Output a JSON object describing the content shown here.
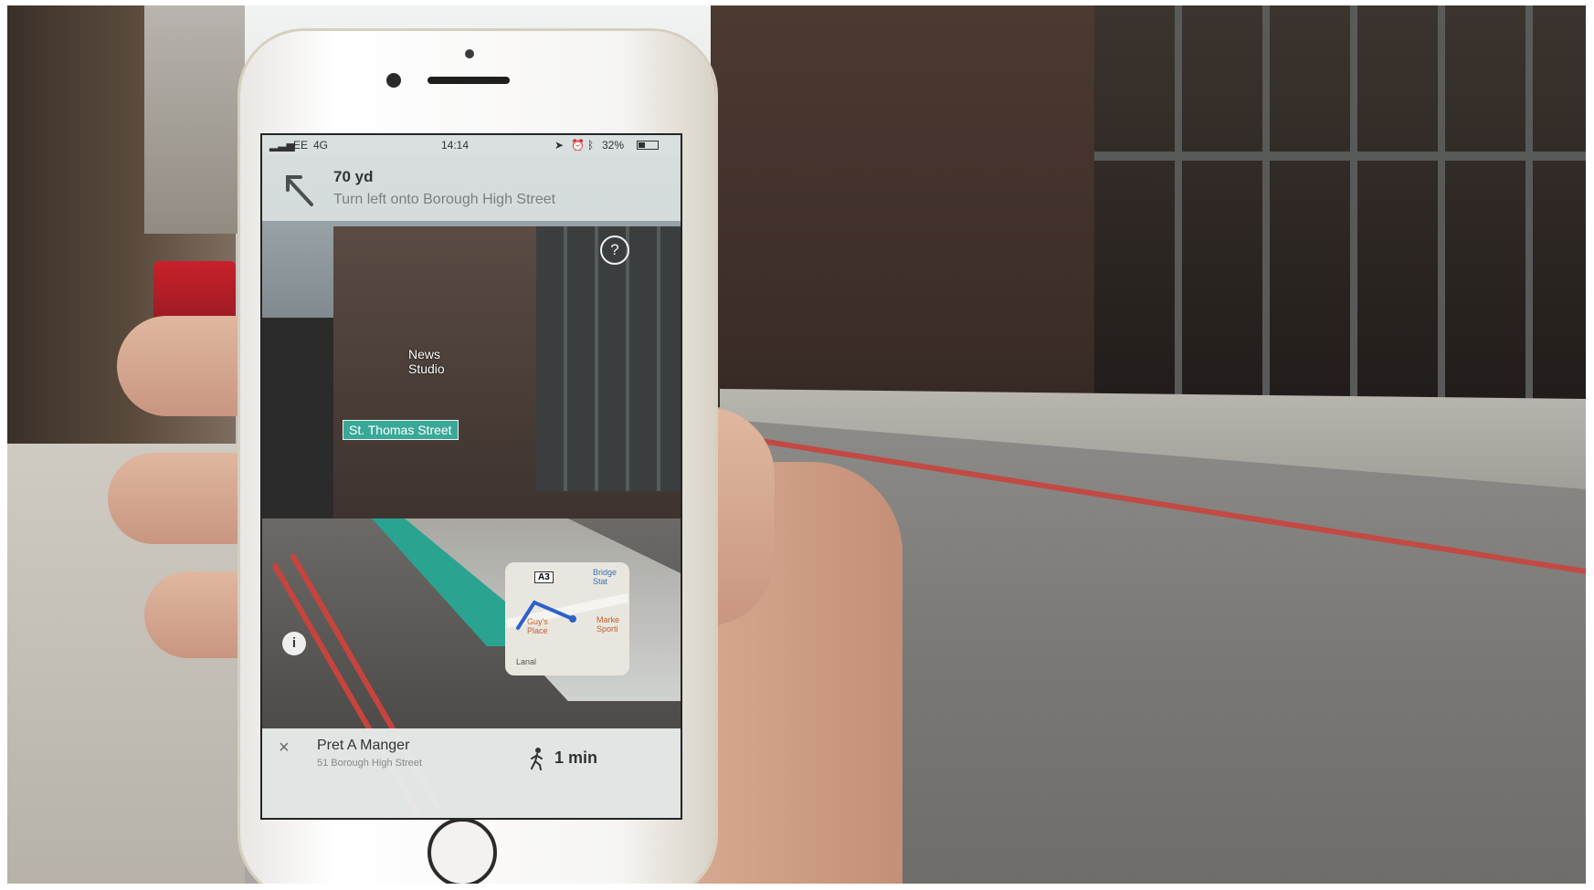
{
  "photo": {
    "description_context": "hand-holding-phone-ar-navigation"
  },
  "status_bar": {
    "carrier": "EE",
    "network": "4G",
    "time": "14:14",
    "battery": "32%"
  },
  "navigation": {
    "distance": "70 yd",
    "instruction": "Turn left onto Borough High Street",
    "turn_icon": "arrow-up-left-icon"
  },
  "ar_labels": {
    "street": "St. Thomas Street",
    "poi": [
      "News",
      "Studio"
    ]
  },
  "controls": {
    "help_label": "?",
    "info_label": "i",
    "close_label": "×"
  },
  "minimap": {
    "road_badge": "A3",
    "label_top_right": [
      "Bridge",
      "Stat"
    ],
    "label_left": [
      "Guy's",
      "Place"
    ],
    "label_right": [
      "Marke",
      "Sporti"
    ],
    "label_bottom": "Lanal",
    "route_color": "#2c61c7"
  },
  "destination": {
    "name": "Pret A Manger",
    "address": "51 Borough High Street",
    "eta": "1 min",
    "mode_icon": "walking-person-icon"
  },
  "colors": {
    "ar_route": "#2aa391",
    "street_label_bg": "#3aa898"
  }
}
